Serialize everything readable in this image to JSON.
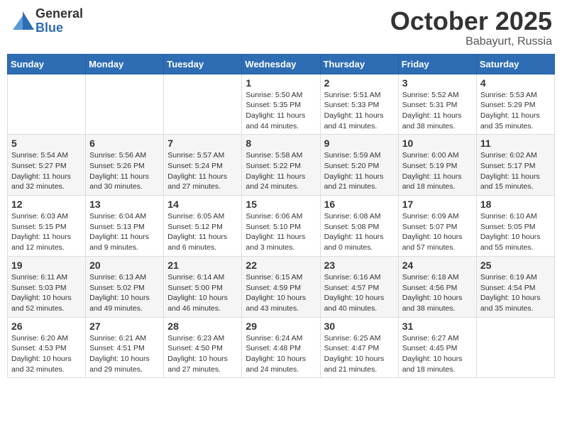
{
  "header": {
    "logo_general": "General",
    "logo_blue": "Blue",
    "month": "October 2025",
    "location": "Babayurt, Russia"
  },
  "weekdays": [
    "Sunday",
    "Monday",
    "Tuesday",
    "Wednesday",
    "Thursday",
    "Friday",
    "Saturday"
  ],
  "weeks": [
    [
      {
        "day": "",
        "info": ""
      },
      {
        "day": "",
        "info": ""
      },
      {
        "day": "",
        "info": ""
      },
      {
        "day": "1",
        "info": "Sunrise: 5:50 AM\nSunset: 5:35 PM\nDaylight: 11 hours\nand 44 minutes."
      },
      {
        "day": "2",
        "info": "Sunrise: 5:51 AM\nSunset: 5:33 PM\nDaylight: 11 hours\nand 41 minutes."
      },
      {
        "day": "3",
        "info": "Sunrise: 5:52 AM\nSunset: 5:31 PM\nDaylight: 11 hours\nand 38 minutes."
      },
      {
        "day": "4",
        "info": "Sunrise: 5:53 AM\nSunset: 5:29 PM\nDaylight: 11 hours\nand 35 minutes."
      }
    ],
    [
      {
        "day": "5",
        "info": "Sunrise: 5:54 AM\nSunset: 5:27 PM\nDaylight: 11 hours\nand 32 minutes."
      },
      {
        "day": "6",
        "info": "Sunrise: 5:56 AM\nSunset: 5:26 PM\nDaylight: 11 hours\nand 30 minutes."
      },
      {
        "day": "7",
        "info": "Sunrise: 5:57 AM\nSunset: 5:24 PM\nDaylight: 11 hours\nand 27 minutes."
      },
      {
        "day": "8",
        "info": "Sunrise: 5:58 AM\nSunset: 5:22 PM\nDaylight: 11 hours\nand 24 minutes."
      },
      {
        "day": "9",
        "info": "Sunrise: 5:59 AM\nSunset: 5:20 PM\nDaylight: 11 hours\nand 21 minutes."
      },
      {
        "day": "10",
        "info": "Sunrise: 6:00 AM\nSunset: 5:19 PM\nDaylight: 11 hours\nand 18 minutes."
      },
      {
        "day": "11",
        "info": "Sunrise: 6:02 AM\nSunset: 5:17 PM\nDaylight: 11 hours\nand 15 minutes."
      }
    ],
    [
      {
        "day": "12",
        "info": "Sunrise: 6:03 AM\nSunset: 5:15 PM\nDaylight: 11 hours\nand 12 minutes."
      },
      {
        "day": "13",
        "info": "Sunrise: 6:04 AM\nSunset: 5:13 PM\nDaylight: 11 hours\nand 9 minutes."
      },
      {
        "day": "14",
        "info": "Sunrise: 6:05 AM\nSunset: 5:12 PM\nDaylight: 11 hours\nand 6 minutes."
      },
      {
        "day": "15",
        "info": "Sunrise: 6:06 AM\nSunset: 5:10 PM\nDaylight: 11 hours\nand 3 minutes."
      },
      {
        "day": "16",
        "info": "Sunrise: 6:08 AM\nSunset: 5:08 PM\nDaylight: 11 hours\nand 0 minutes."
      },
      {
        "day": "17",
        "info": "Sunrise: 6:09 AM\nSunset: 5:07 PM\nDaylight: 10 hours\nand 57 minutes."
      },
      {
        "day": "18",
        "info": "Sunrise: 6:10 AM\nSunset: 5:05 PM\nDaylight: 10 hours\nand 55 minutes."
      }
    ],
    [
      {
        "day": "19",
        "info": "Sunrise: 6:11 AM\nSunset: 5:03 PM\nDaylight: 10 hours\nand 52 minutes."
      },
      {
        "day": "20",
        "info": "Sunrise: 6:13 AM\nSunset: 5:02 PM\nDaylight: 10 hours\nand 49 minutes."
      },
      {
        "day": "21",
        "info": "Sunrise: 6:14 AM\nSunset: 5:00 PM\nDaylight: 10 hours\nand 46 minutes."
      },
      {
        "day": "22",
        "info": "Sunrise: 6:15 AM\nSunset: 4:59 PM\nDaylight: 10 hours\nand 43 minutes."
      },
      {
        "day": "23",
        "info": "Sunrise: 6:16 AM\nSunset: 4:57 PM\nDaylight: 10 hours\nand 40 minutes."
      },
      {
        "day": "24",
        "info": "Sunrise: 6:18 AM\nSunset: 4:56 PM\nDaylight: 10 hours\nand 38 minutes."
      },
      {
        "day": "25",
        "info": "Sunrise: 6:19 AM\nSunset: 4:54 PM\nDaylight: 10 hours\nand 35 minutes."
      }
    ],
    [
      {
        "day": "26",
        "info": "Sunrise: 6:20 AM\nSunset: 4:53 PM\nDaylight: 10 hours\nand 32 minutes."
      },
      {
        "day": "27",
        "info": "Sunrise: 6:21 AM\nSunset: 4:51 PM\nDaylight: 10 hours\nand 29 minutes."
      },
      {
        "day": "28",
        "info": "Sunrise: 6:23 AM\nSunset: 4:50 PM\nDaylight: 10 hours\nand 27 minutes."
      },
      {
        "day": "29",
        "info": "Sunrise: 6:24 AM\nSunset: 4:48 PM\nDaylight: 10 hours\nand 24 minutes."
      },
      {
        "day": "30",
        "info": "Sunrise: 6:25 AM\nSunset: 4:47 PM\nDaylight: 10 hours\nand 21 minutes."
      },
      {
        "day": "31",
        "info": "Sunrise: 6:27 AM\nSunset: 4:45 PM\nDaylight: 10 hours\nand 18 minutes."
      },
      {
        "day": "",
        "info": ""
      }
    ]
  ]
}
